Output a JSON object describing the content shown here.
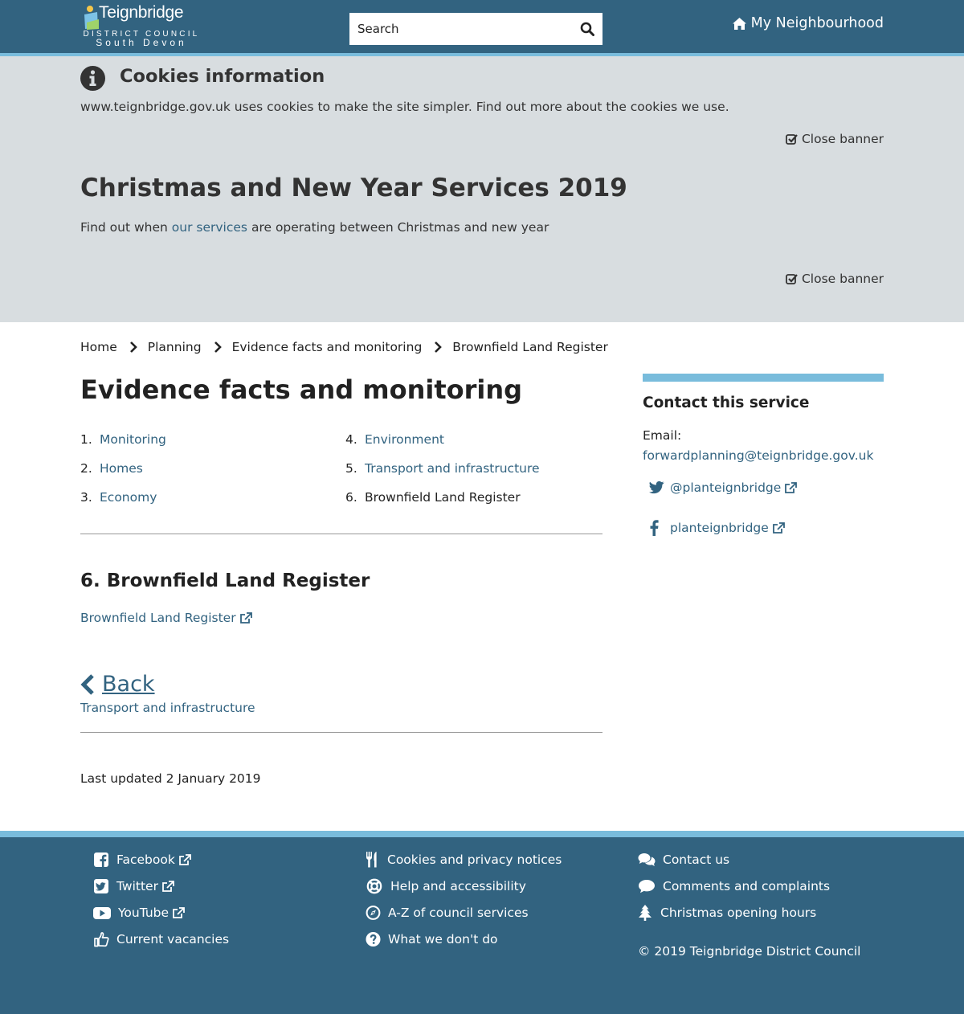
{
  "colors": {
    "header_bg": "#326380",
    "accent": "#79bcdc",
    "banner_bg": "#d8dde0",
    "link": "#326380"
  },
  "header": {
    "logo": {
      "name": "Teignbridge",
      "line1": "DISTRICT COUNCIL",
      "line2": "South Devon"
    },
    "search": {
      "placeholder": "Search",
      "icon": "search-icon"
    },
    "neighbourhood": {
      "label": "My Neighbourhood",
      "icon": "home-icon"
    }
  },
  "cookie_banner": {
    "title": "Cookies information",
    "text": "www.teignbridge.gov.uk uses cookies to make the site simpler.",
    "link": "Find out more about the cookies we use",
    "close_label": "Close banner"
  },
  "xmas_banner": {
    "title": "Christmas and New Year Services 2019",
    "text_before": "Find out when",
    "link": "our services",
    "text_after": "are operating between Christmas and new year",
    "close_label": "Close banner"
  },
  "breadcrumb": [
    "Home",
    "Planning",
    "Evidence facts and monitoring",
    "Brownfield Land Register"
  ],
  "page_title": "Evidence facts and monitoring",
  "toc": [
    {
      "num": "1.",
      "label": "Monitoring",
      "current": false
    },
    {
      "num": "2.",
      "label": "Homes",
      "current": false
    },
    {
      "num": "3.",
      "label": "Economy",
      "current": false
    },
    {
      "num": "4.",
      "label": "Environment",
      "current": false
    },
    {
      "num": "5.",
      "label": "Transport and infrastructure",
      "current": false
    },
    {
      "num": "6.",
      "label": "Brownfield Land Register",
      "current": true
    }
  ],
  "section": {
    "title": "6. Brownfield Land Register",
    "link": "Brownfield Land Register"
  },
  "back": {
    "label": "Back",
    "sub": "Transport and infrastructure"
  },
  "last_updated": "Last updated 2 January 2019",
  "sidebar": {
    "title": "Contact this service",
    "email_label": "Email:",
    "email": "forwardplanning@teignbridge.gov.uk",
    "twitter": "@planteignbridge",
    "facebook": "planteignbridge"
  },
  "footer": {
    "col1": [
      {
        "label": "Facebook",
        "icon": "facebook-square-icon",
        "external": true
      },
      {
        "label": "Twitter",
        "icon": "twitter-square-icon",
        "external": true
      },
      {
        "label": "YouTube",
        "icon": "youtube-icon",
        "external": true
      },
      {
        "label": "Current vacancies",
        "icon": "thumbs-up-icon",
        "external": false
      }
    ],
    "col2": [
      {
        "label": "Cookies and privacy notices",
        "icon": "cutlery-icon"
      },
      {
        "label": "Help and accessibility",
        "icon": "life-ring-icon"
      },
      {
        "label": "A-Z of council services",
        "icon": "compass-icon"
      },
      {
        "label": "What we don't do",
        "icon": "question-circle-icon"
      }
    ],
    "col3": [
      {
        "label": "Contact us",
        "icon": "comments-icon"
      },
      {
        "label": "Comments and complaints",
        "icon": "comment-icon"
      },
      {
        "label": "Christmas opening hours",
        "icon": "tree-icon"
      }
    ],
    "copyright": "© 2019 Teignbridge District Council"
  }
}
